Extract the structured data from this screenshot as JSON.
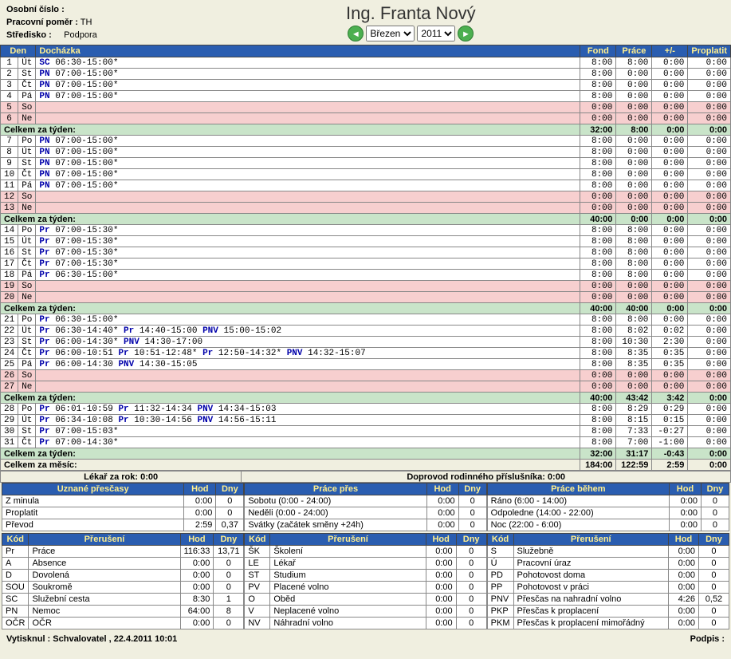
{
  "header": {
    "personal_no_label": "Osobní číslo :",
    "personal_no_value": "",
    "work_rel_label": "Pracovní poměr :",
    "work_rel_value": "TH",
    "center_label": "Středisko :",
    "center_value": "Podpora",
    "title": "Ing. Franta Nový",
    "month_options": [
      "Březen"
    ],
    "year_options": [
      "2011"
    ],
    "month_value": "Březen",
    "year_value": "2011"
  },
  "columns": {
    "den": "Den",
    "dochazka": "Docházka",
    "fond": "Fond",
    "prace": "Práce",
    "pm": "+/-",
    "proplatit": "Proplatit"
  },
  "week_label": "Celkem za týden:",
  "month_label": "Celkem za měsíc:",
  "rows": [
    {
      "n": "1",
      "d": "Út",
      "txt": "SC 06:30-15:00*",
      "f": "8:00",
      "p": "8:00",
      "pm": "0:00",
      "pr": "0:00"
    },
    {
      "n": "2",
      "d": "St",
      "txt": "PN 07:00-15:00*",
      "f": "8:00",
      "p": "0:00",
      "pm": "0:00",
      "pr": "0:00"
    },
    {
      "n": "3",
      "d": "Čt",
      "txt": "PN 07:00-15:00*",
      "f": "8:00",
      "p": "0:00",
      "pm": "0:00",
      "pr": "0:00"
    },
    {
      "n": "4",
      "d": "Pá",
      "txt": "PN 07:00-15:00*",
      "f": "8:00",
      "p": "0:00",
      "pm": "0:00",
      "pr": "0:00"
    },
    {
      "n": "5",
      "d": "So",
      "txt": "",
      "f": "0:00",
      "p": "0:00",
      "pm": "0:00",
      "pr": "0:00",
      "weekend": true
    },
    {
      "n": "6",
      "d": "Ne",
      "txt": "",
      "f": "0:00",
      "p": "0:00",
      "pm": "0:00",
      "pr": "0:00",
      "weekend": true
    },
    {
      "sum": true,
      "f": "32:00",
      "p": "8:00",
      "pm": "0:00",
      "pr": "0:00"
    },
    {
      "n": "7",
      "d": "Po",
      "txt": "PN 07:00-15:00*",
      "f": "8:00",
      "p": "0:00",
      "pm": "0:00",
      "pr": "0:00"
    },
    {
      "n": "8",
      "d": "Út",
      "txt": "PN 07:00-15:00*",
      "f": "8:00",
      "p": "0:00",
      "pm": "0:00",
      "pr": "0:00"
    },
    {
      "n": "9",
      "d": "St",
      "txt": "PN 07:00-15:00*",
      "f": "8:00",
      "p": "0:00",
      "pm": "0:00",
      "pr": "0:00"
    },
    {
      "n": "10",
      "d": "Čt",
      "txt": "PN 07:00-15:00*",
      "f": "8:00",
      "p": "0:00",
      "pm": "0:00",
      "pr": "0:00"
    },
    {
      "n": "11",
      "d": "Pá",
      "txt": "PN 07:00-15:00*",
      "f": "8:00",
      "p": "0:00",
      "pm": "0:00",
      "pr": "0:00"
    },
    {
      "n": "12",
      "d": "So",
      "txt": "",
      "f": "0:00",
      "p": "0:00",
      "pm": "0:00",
      "pr": "0:00",
      "weekend": true
    },
    {
      "n": "13",
      "d": "Ne",
      "txt": "",
      "f": "0:00",
      "p": "0:00",
      "pm": "0:00",
      "pr": "0:00",
      "weekend": true
    },
    {
      "sum": true,
      "f": "40:00",
      "p": "0:00",
      "pm": "0:00",
      "pr": "0:00"
    },
    {
      "n": "14",
      "d": "Po",
      "txt": "Pr 07:00-15:30*",
      "f": "8:00",
      "p": "8:00",
      "pm": "0:00",
      "pr": "0:00"
    },
    {
      "n": "15",
      "d": "Út",
      "txt": "Pr 07:00-15:30*",
      "f": "8:00",
      "p": "8:00",
      "pm": "0:00",
      "pr": "0:00"
    },
    {
      "n": "16",
      "d": "St",
      "txt": "Pr 07:00-15:30*",
      "f": "8:00",
      "p": "8:00",
      "pm": "0:00",
      "pr": "0:00"
    },
    {
      "n": "17",
      "d": "Čt",
      "txt": "Pr 07:00-15:30*",
      "f": "8:00",
      "p": "8:00",
      "pm": "0:00",
      "pr": "0:00"
    },
    {
      "n": "18",
      "d": "Pá",
      "txt": "Pr 06:30-15:00*",
      "f": "8:00",
      "p": "8:00",
      "pm": "0:00",
      "pr": "0:00"
    },
    {
      "n": "19",
      "d": "So",
      "txt": "",
      "f": "0:00",
      "p": "0:00",
      "pm": "0:00",
      "pr": "0:00",
      "weekend": true
    },
    {
      "n": "20",
      "d": "Ne",
      "txt": "",
      "f": "0:00",
      "p": "0:00",
      "pm": "0:00",
      "pr": "0:00",
      "weekend": true
    },
    {
      "sum": true,
      "f": "40:00",
      "p": "40:00",
      "pm": "0:00",
      "pr": "0:00"
    },
    {
      "n": "21",
      "d": "Po",
      "txt": "Pr 06:30-15:00*",
      "f": "8:00",
      "p": "8:00",
      "pm": "0:00",
      "pr": "0:00"
    },
    {
      "n": "22",
      "d": "Út",
      "txt": "Pr 06:30-14:40*  Pr 14:40-15:00  PNV 15:00-15:02",
      "f": "8:00",
      "p": "8:02",
      "pm": "0:02",
      "pr": "0:00"
    },
    {
      "n": "23",
      "d": "St",
      "txt": "Pr 06:00-14:30* PNV 14:30-17:00",
      "f": "8:00",
      "p": "10:30",
      "pm": "2:30",
      "pr": "0:00"
    },
    {
      "n": "24",
      "d": "Čt",
      "txt": "Pr 06:00-10:51   Pr 10:51-12:48*  Pr 12:50-14:32* PNV 14:32-15:07",
      "f": "8:00",
      "p": "8:35",
      "pm": "0:35",
      "pr": "0:00"
    },
    {
      "n": "25",
      "d": "Pá",
      "txt": "Pr 06:00-14:30  PNV 14:30-15:05",
      "f": "8:00",
      "p": "8:35",
      "pm": "0:35",
      "pr": "0:00"
    },
    {
      "n": "26",
      "d": "So",
      "txt": "",
      "f": "0:00",
      "p": "0:00",
      "pm": "0:00",
      "pr": "0:00",
      "weekend": true
    },
    {
      "n": "27",
      "d": "Ne",
      "txt": "",
      "f": "0:00",
      "p": "0:00",
      "pm": "0:00",
      "pr": "0:00",
      "weekend": true
    },
    {
      "sum": true,
      "f": "40:00",
      "p": "43:42",
      "pm": "3:42",
      "pr": "0:00"
    },
    {
      "n": "28",
      "d": "Po",
      "txt": "Pr 06:01-10:59   Pr 11:32-14:34  PNV 14:34-15:03",
      "f": "8:00",
      "p": "8:29",
      "pm": "0:29",
      "pr": "0:00"
    },
    {
      "n": "29",
      "d": "Út",
      "txt": "Pr 06:34-10:08   Pr 10:30-14:56  PNV 14:56-15:11",
      "f": "8:00",
      "p": "8:15",
      "pm": "0:15",
      "pr": "0:00"
    },
    {
      "n": "30",
      "d": "St",
      "txt": "Pr 07:00-15:03*",
      "f": "8:00",
      "p": "7:33",
      "pm": "-0:27",
      "pr": "0:00"
    },
    {
      "n": "31",
      "d": "Čt",
      "txt": "Pr 07:00-14:30*",
      "f": "8:00",
      "p": "7:00",
      "pm": "-1:00",
      "pr": "0:00"
    },
    {
      "sum": true,
      "f": "32:00",
      "p": "31:17",
      "pm": "-0:43",
      "pr": "0:00"
    }
  ],
  "month_totals": {
    "f": "184:00",
    "p": "122:59",
    "pm": "2:59",
    "pr": "0:00"
  },
  "info": {
    "doctor": "Lékař za rok: 0:00",
    "escort": "Doprovod rodinného příslušníka: 0:00"
  },
  "overtime": {
    "hdr": [
      "Uznané přesčasy",
      "Hod",
      "Dny"
    ],
    "rows": [
      [
        "Z minula",
        "0:00",
        "0"
      ],
      [
        "Proplatit",
        "0:00",
        "0"
      ],
      [
        "Převod",
        "2:59",
        "0,37"
      ]
    ]
  },
  "workover": {
    "hdr": [
      "Práce přes",
      "Hod",
      "Dny"
    ],
    "rows": [
      [
        "Sobotu (0:00 - 24:00)",
        "0:00",
        "0"
      ],
      [
        "Neděli (0:00 - 24:00)",
        "0:00",
        "0"
      ],
      [
        "Svátky (začátek směny +24h)",
        "0:00",
        "0"
      ]
    ]
  },
  "workduring": {
    "hdr": [
      "Práce během",
      "Hod",
      "Dny"
    ],
    "rows": [
      [
        "Ráno (6:00 - 14:00)",
        "0:00",
        "0"
      ],
      [
        "Odpoledne (14:00 - 22:00)",
        "0:00",
        "0"
      ],
      [
        "Noc (22:00 - 6:00)",
        "0:00",
        "0"
      ]
    ]
  },
  "interrupts_hdr": [
    "Kód",
    "Přerušení",
    "Hod",
    "Dny"
  ],
  "interrupts": [
    [
      "Pr",
      "Práce",
      "116:33",
      "13,71"
    ],
    [
      "A",
      "Absence",
      "0:00",
      "0"
    ],
    [
      "D",
      "Dovolená",
      "0:00",
      "0"
    ],
    [
      "SOU",
      "Soukromě",
      "0:00",
      "0"
    ],
    [
      "SC",
      "Služební cesta",
      "8:30",
      "1"
    ],
    [
      "PN",
      "Nemoc",
      "64:00",
      "8"
    ],
    [
      "OČR",
      "OČR",
      "0:00",
      "0"
    ],
    [
      "ŠK",
      "Školení",
      "0:00",
      "0"
    ],
    [
      "LE",
      "Lékař",
      "0:00",
      "0"
    ],
    [
      "ST",
      "Studium",
      "0:00",
      "0"
    ],
    [
      "PV",
      "Placené volno",
      "0:00",
      "0"
    ],
    [
      "O",
      "Oběd",
      "0:00",
      "0"
    ],
    [
      "V",
      "Neplacené volno",
      "0:00",
      "0"
    ],
    [
      "NV",
      "Náhradní volno",
      "0:00",
      "0"
    ],
    [
      "S",
      "Služebně",
      "0:00",
      "0"
    ],
    [
      "Ú",
      "Pracovní úraz",
      "0:00",
      "0"
    ],
    [
      "PD",
      "Pohotovost doma",
      "0:00",
      "0"
    ],
    [
      "PP",
      "Pohotovost v práci",
      "0:00",
      "0"
    ],
    [
      "PNV",
      "Přesčas na nahradní volno",
      "4:26",
      "0,52"
    ],
    [
      "PKP",
      "Přesčas k proplacení",
      "0:00",
      "0"
    ],
    [
      "PKM",
      "Přesčas k proplacení mimořádný",
      "0:00",
      "0"
    ]
  ],
  "footer": {
    "printed": "Vytisknul : Schvalovatel , 22.4.2011  10:01",
    "sig": "Podpis :"
  }
}
